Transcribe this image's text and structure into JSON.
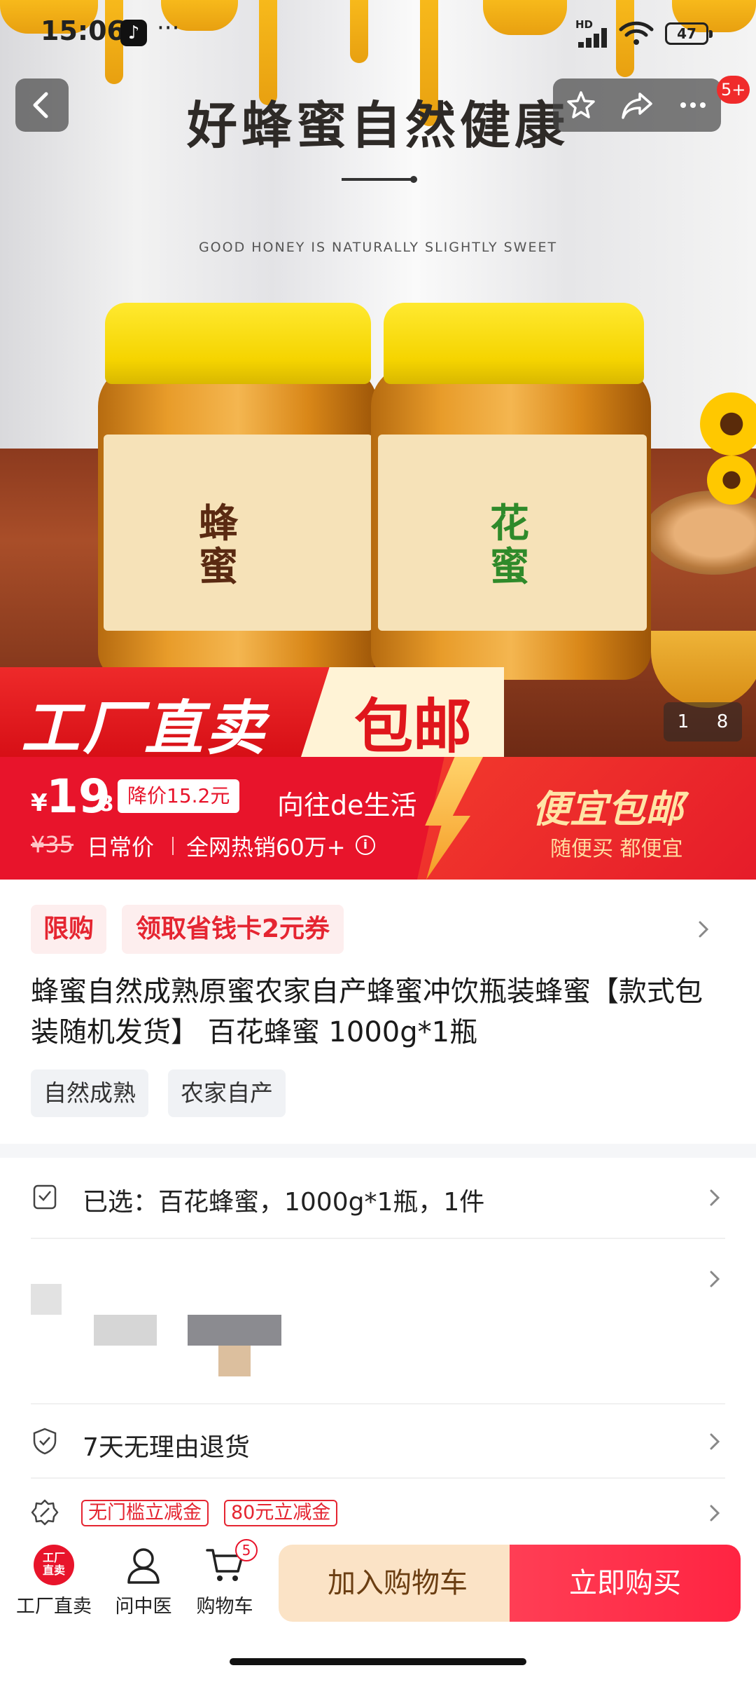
{
  "status_bar": {
    "time": "15:06",
    "hd": "HD",
    "battery": "47"
  },
  "nav": {
    "message_badge": "5+"
  },
  "hero": {
    "title": "好蜂蜜自然健康",
    "subtitle": "GOOD HONEY IS NATURALLY SLIGHTLY SWEET",
    "jar_left_label": "蜂蜜",
    "jar_right_label": "花蜜",
    "banner_left": "工厂直卖",
    "banner_right": "包邮",
    "image_index": "1",
    "image_total": "8"
  },
  "price": {
    "yen": "¥",
    "main": "19",
    "decimal": ".8",
    "drop_badge": "降价15.2元",
    "shop_name": "向往de生活",
    "original": "¥35",
    "daily_label": "日常价",
    "sales": "全网热销60万+",
    "info_icon": "i",
    "promo_title": "便宜包邮",
    "promo_sub": "随便买 都便宜"
  },
  "coupons": {
    "limit": "限购",
    "coupon": "领取省钱卡2元券"
  },
  "product": {
    "title": "蜂蜜自然成熟原蜜农家自产蜂蜜冲饮瓶装蜂蜜【款式包装随机发货】 百花蜂蜜 1000g*1瓶",
    "tags": [
      "自然成熟",
      "农家自产"
    ]
  },
  "rows": {
    "selected": "已选：百花蜂蜜，1000g*1瓶，1件",
    "return_policy": "7天无理由退货",
    "discount_tags": [
      "无门槛立减金",
      "80元立减金"
    ]
  },
  "bottom_bar": {
    "factory_badge": "工厂\n直卖",
    "factory": "工厂直卖",
    "doctor": "问中医",
    "cart": "购物车",
    "cart_count": "5",
    "add_to_cart": "加入购物车",
    "buy_now": "立即购买"
  },
  "colors": {
    "accent_red": "#e8142b",
    "buy_button": "#ff2442",
    "cart_button": "#fbe3c6",
    "honey": "#f4b650"
  }
}
